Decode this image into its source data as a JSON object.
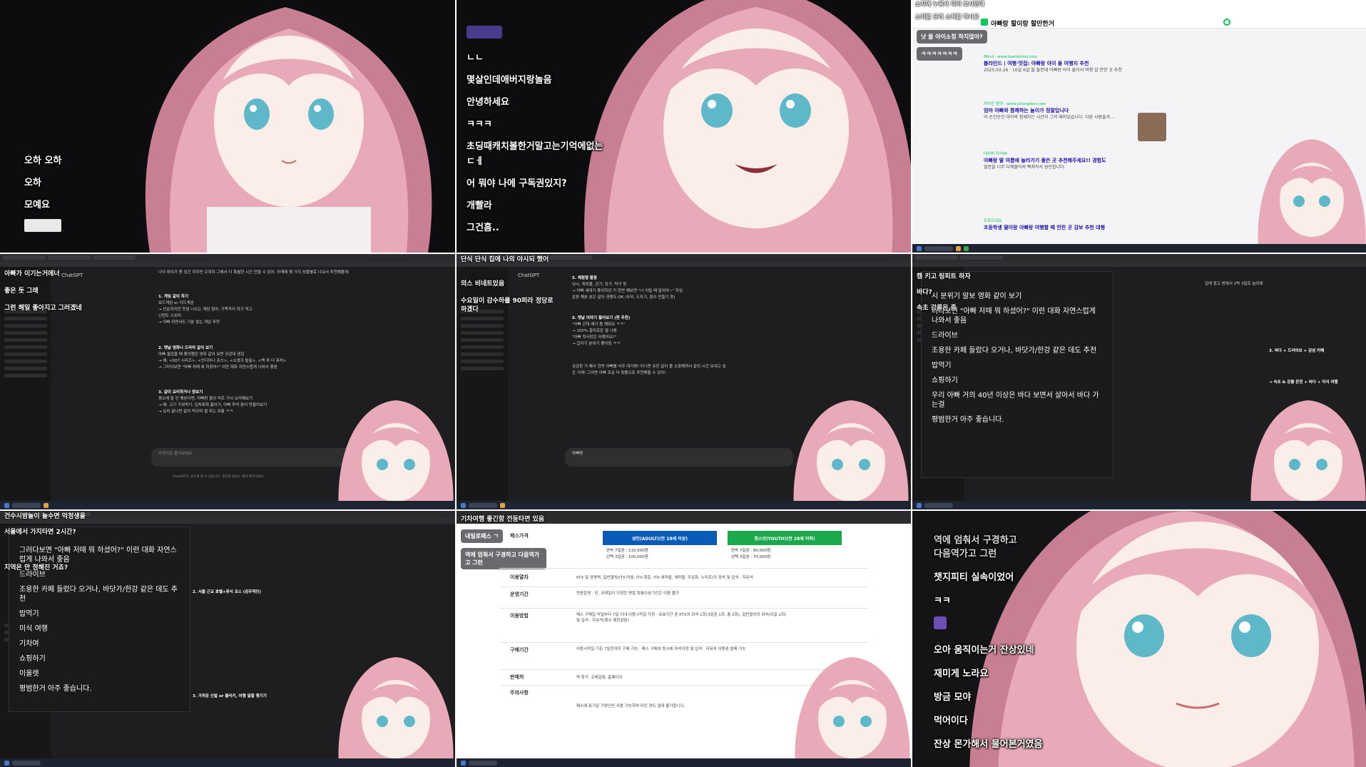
{
  "panel1": {
    "chat": [
      "오하 오하",
      "오하",
      "모예요"
    ]
  },
  "panel2": {
    "chat": [
      "ㄴㄴ",
      "몇살인데애버지랑놀음",
      "안녕하세요",
      "ㅋㅋㅋ",
      "초딩때캐치볼한거말고는기억에없는",
      "ㄷㅔ",
      "어 뭐야 나에 구독권있지?",
      "개빨라",
      "그건흠.."
    ]
  },
  "panel3": {
    "overlay_top": "소지에 누워서 티비 보시던데",
    "overlay_top2": "소처럼 드러 소처럼 하시고",
    "bubble1": "낫 돌 아이소칭 하지않아?",
    "bubble2": "ㅋㅋㅋㅋㅋㅋㅋ",
    "search_query": "아빠랑 할이랑 할만한거",
    "results": [
      {
        "source": "Blind · www.teamblind.com",
        "title": "블라인드 | 여행·맛집: 아빠랑 아이 둘 여행지 추천",
        "snippet": "2025.03.26 · 10살 6살 딸 둘인데 아빠랑 아이 둘이서 여행 갈 만한 곳 추천"
      },
      {
        "source": "자이언 참여 · www.changdao.com",
        "title": "엄마 아빠와 함께하는 놀이가 정말입니다",
        "snippet": "이 순간순간 아이와 함께하는 시간이 그저 재미있습니다. 다른 사람들과..."
      },
      {
        "source": "네이버 지식iN",
        "title": "아빠랑 딸 여름에 놀러가기 좋은 곳 추천해주세요!! 경험도",
        "snippet": "질문을 너무 다해줄어져 빡쳐하서 원인합니다."
      },
      {
        "source": "도와드려요",
        "title": "초등학생 딸이랑 아빠랑 여행할 때 안전 곳 감보 추천 대행",
        "snippet": ""
      }
    ]
  },
  "panel4": {
    "overlay": [
      "아빠가 이기는거에너",
      "좋은 듯 그래",
      "그런 해일 좋아지고 그러겠네"
    ],
    "app_title": "ChatGPT",
    "intro": "나이 차이가 좀 있긴 하지만 오히려 그래서 더 특별한 시간 만들 수 있어. 아래에 몇 가지 상황별로 나눠서 추천해볼게:",
    "sections": [
      {
        "title": "1. 게임 같이 하기",
        "bullets": [
          "보드게임 or 카드게임",
          "→ 단순하지만 웃음 나오는 게임 많아, 가족끼리 하기 적고",
          "닌텐도 스위치",
          "→ 아빠 하면서도 기분 쌓는 게임 추천"
        ]
      },
      {
        "title": "2. 옛날 영화나 드라마 같이 보기",
        "bullets": [
          "아빠 젊었을 때 좋아했던 영화 같이 보면 공감대 생김",
          "→ 예: <007 시리즈>, <인디아나 존스>, <쇼생크 탈출>, <백 투 더 퓨처>",
          "→ 그러다보면 \"아빠 저때 뭐 하셨어?\" 이런 대화 자연스럽게 나와서 좋음"
        ]
      },
      {
        "title": "3. 같이 요리하거나 장보기",
        "bullets": [
          "평소에 잘 안 해본다면, 아빠랑 둘이 마트 가서 요리해보기",
          "→ 예: 고기 구워먹기, 김치찌개 끓이기, 아빠 추억 음식 만들어보기",
          "→ 요리 끝나면 같이 먹으며 썰 푸는 흐름 ㅋㅋ"
        ]
      }
    ],
    "input_placeholder": "무엇이든 물어보세요",
    "footer": "ChatGPT는 실수를 할 수 있습니다. 중요한 정보는 재차 확인하세요."
  },
  "panel5": {
    "overlay": [
      "단식 단식 집에 나의 야시되 했어",
      "의스 비네트있음",
      "수요일이 감수하를 90퍼라 정당로",
      "하겠다"
    ],
    "app_title": "ChatGPT",
    "sections": [
      {
        "title": "5. 체험형 활동",
        "bullets": [
          "낚시, 캐치볼, 걷기, 당구, 탁구 등",
          "→ 아빠 세대가 좋아하던 거 한번 해보면 \"너 어릴 때 말이야~\" 하심",
          "운동 해본 분은 같이 경쟁도 OK (두꺼, 도자기, 향수 만들기 등)"
        ]
      },
      {
        "title": "6. 옛날 이야기 들어보기 (찐 추천)",
        "bullets": [
          "\"아빠 군대 얘기 좀 해줘요 ㅋㅋ\"",
          "→ 100% 흥미로운 썰 나옴",
          "\"아빠 첫사랑은 어땠어요?\"",
          "→ 갑자기 분위기 좋아짐 ㅋㅋ"
        ]
      }
    ],
    "closing": "궁금한 거 해서 한번 아빠를 사주 대가봐! 아니면 유진 같이 즐 소중해져서 같이 시간 보내고 싶은 거래! 그러면 아빠 조금 더 맞춤으로 추천해줄 수 있어!",
    "input_value": "아빠랑"
  },
  "panel6": {
    "overlay": [
      "캠 키고 링피트 하자",
      "바다?",
      "속초 강릉은 좀"
    ],
    "popup_lines": [
      "시 분위기 알보 영화 같이 보기",
      "러다보면 \"아빠 저때 뭐 하셨어?\" 이런 대화 자연스럽게 나와서 좋음",
      "드라이브",
      "조용한 카페 들렀다 오거나, 바닷가/한강 같은 데도 추천",
      "밥먹기",
      "쇼핑하기",
      "우리 아빠 거의 40년 이상은 바다 보면서 살아서 바다 가는걸",
      "평범한거 아주 좋습니다."
    ],
    "right_text": [
      "답에 잠고 방에서 2박 3일로 늘려에",
      "3. 바다 + 드라이브 + 감성 카페",
      "→ 속초 & 강릉 온천 + 바다 + 미식 여행"
    ]
  },
  "panel7": {
    "overlay": [
      "건수시밤놀이 놀수면 억청생을",
      "서울에서 가지타면 2시간?",
      "지역은 안 정해진 거죠?"
    ],
    "popup_lines": [
      "그러다보면 \"아빠 저때 뭐 하셨어?\" 이런 대화 자연스럽게 나와서 좋음",
      "드라이브",
      "조용한 카페 들렀다 오거나, 바닷가/한강 같은 데도 추천",
      "밥먹기",
      "미식 여행",
      "기차여",
      "쇼핑하기",
      "이울렛",
      "평범한거 아주 좋습니다."
    ],
    "right_text": [
      "2. 서울 근교 호텔+휴식 코스 (감주적인)",
      "3. 가까운 신발 or 올리키, 여행 말할 챙기기"
    ]
  },
  "panel8": {
    "overlay_top": "기차여행 좋긴함 전동타면 있음",
    "bubble1": "내일로패스 ㄱ",
    "bubble2": "역에 엄춰서 구경하고 다음역가고 그런",
    "pass_price_label": "패스가격",
    "adult": {
      "title": "성인(ADULT)(만 28세 이상)",
      "lines": [
        "연속 7일권 : 110,000원",
        "선택 3일권 : 100,000원"
      ]
    },
    "youth": {
      "title": "청소년(YOUTH)(만 28세 이하)",
      "lines": [
        "연속 7일권 : 80,000원",
        "선택 3일권 : 70,000원"
      ]
    },
    "rows": [
      {
        "label": "이용열차",
        "text": "KTX 및 광명역, 일반열차(ITX-마음, ITX-청춘, ITX-새마을, 새마을, 무궁화, 누리로)의 좌석 및 입석 · 자유석"
      },
      {
        "label": "운영기간",
        "text": "연중운영 · 단, 코레일이 지정한 명절 특별수송기간은 이용 불가"
      },
      {
        "label": "이용방법",
        "text": "패스 구매일 익일부터 7일 이내 이용시작일 지정 · 유효기간 중 KTX의 좌석 1회(3일권 1회, 총 2회), 일반열차의 좌석(이일 2회) 및 입석 · 자유석(횟수 제한없음)"
      },
      {
        "label": "구매기간",
        "text": "이용시작일 기준 7일전까지 구매 가능 · 패스 구매와 동시에 좌석지정 및 입석 · 자유석 이용권 발매 가능"
      },
      {
        "label": "판매처",
        "text": "역 창구, 코레일톡, 홈페이지"
      },
      {
        "label": "주의사항",
        "text": "패스에 표기된 기명인만 사용 가능하며 타인 양도 절대 불가합니다."
      }
    ]
  },
  "panel9": {
    "chat": [
      "역에 엄춰서 구경하고 다음역가고 그런",
      "챗지피티 실속이었어",
      "ㅋㅋ",
      "오아 움직이는거 잔상있네",
      "재미게 노라요",
      "방금 모야",
      "먹어이다",
      "잔상 몬가해서 물어본거였음"
    ]
  },
  "colors": {
    "hair": "#e8a9b8",
    "hair_shadow": "#c97f93",
    "skin": "#fbeee9",
    "eye": "#5fb8c9",
    "naver_green": "#03c75a",
    "korail_blue": "#0a5ab8",
    "korail_green": "#1ba94c"
  }
}
